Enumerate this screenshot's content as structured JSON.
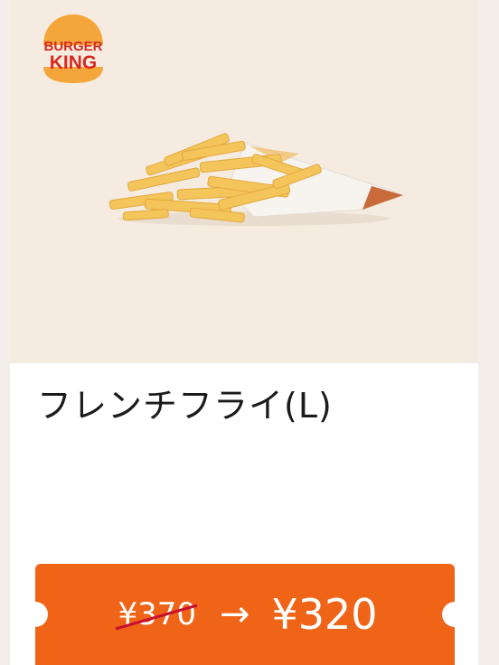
{
  "brand": {
    "logo_text_line1": "BURGER",
    "logo_text_line2": "KING",
    "colors": {
      "bun": "#f5a63a",
      "text": "#d8291f",
      "accent": "#f06418"
    }
  },
  "product": {
    "name": "フレンチフライ(L)",
    "image": "french-fries-icon"
  },
  "coupon": {
    "old_price": "¥370",
    "arrow": "→",
    "new_price": "¥320",
    "strikethrough_color": "#c8102e"
  }
}
